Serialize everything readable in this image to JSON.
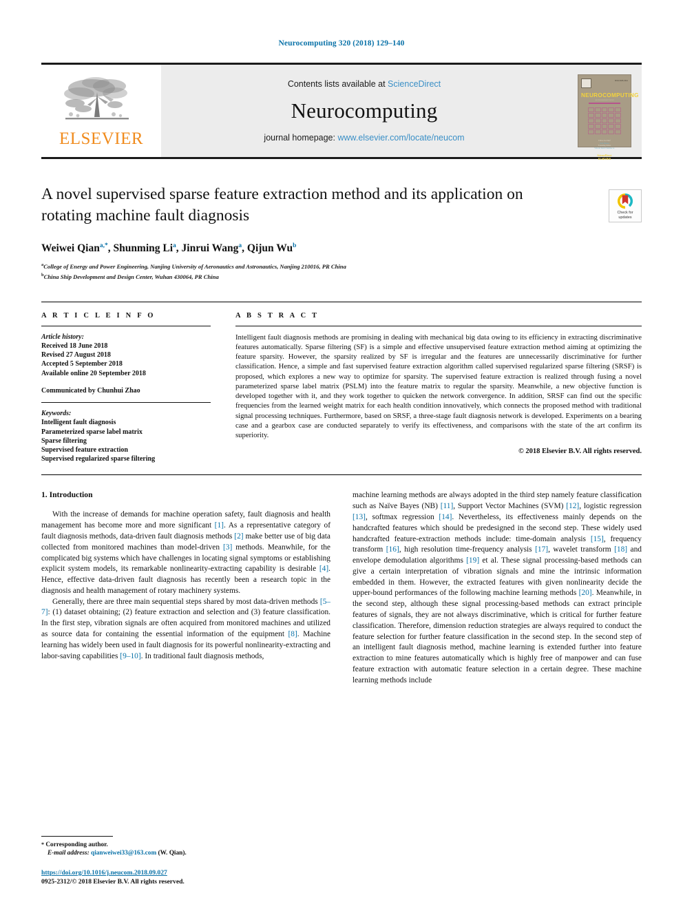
{
  "running_head": "Neurocomputing 320 (2018) 129–140",
  "masthead": {
    "contents_prefix": "Contents lists available at",
    "contents_link": "ScienceDirect",
    "journal_name": "Neurocomputing",
    "homepage_prefix": "journal homepage:",
    "homepage_link": "www.elsevier.com/locate/neucom",
    "publisher_logo_text": "ELSEVIER",
    "cover": {
      "title": "NEUROCOMPUTING",
      "subtitle": "An International Journal",
      "issn": "ISSN 0925-2312",
      "editor_label": "Editor-in-Chief",
      "editor_name": "Tom Heskes",
      "founding_label": "Founding Editor",
      "founding_name": "Vincent David Sánchez A.",
      "publisher_label": "Available online at",
      "publisher_name": "ScienceDirect",
      "publisher_brand": "ELSEVIER"
    }
  },
  "article": {
    "title": "A novel supervised sparse feature extraction method and its application on rotating machine fault diagnosis",
    "authors": [
      {
        "name": "Weiwei Qian",
        "sup": "a,*"
      },
      {
        "name": "Shunming Li",
        "sup": "a"
      },
      {
        "name": "Jinrui Wang",
        "sup": "a"
      },
      {
        "name": "Qijun Wu",
        "sup": "b"
      }
    ],
    "affiliations": [
      {
        "sup": "a",
        "text": "College of Energy and Power Engineering, Nanjing University of Aeronautics and Astronautics, Nanjing 210016, PR China"
      },
      {
        "sup": "b",
        "text": "China Ship Development and Design Center, Wuhan 430064, PR China"
      }
    ],
    "crossmark_label_line1": "Check for",
    "crossmark_label_line2": "updates"
  },
  "article_info": {
    "heading": "A R T I C L E   I N F O",
    "history_label": "Article history:",
    "history": [
      "Received 18 June 2018",
      "Revised 27 August 2018",
      "Accepted 5 September 2018",
      "Available online 20 September 2018"
    ],
    "communicated": "Communicated by Chunhui Zhao",
    "keywords_label": "Keywords:",
    "keywords": [
      "Intelligent fault diagnosis",
      "Parameterized sparse label matrix",
      "Sparse filtering",
      "Supervised feature extraction",
      "Supervised regularized sparse filtering"
    ]
  },
  "abstract": {
    "heading": "A B S T R A C T",
    "text": "Intelligent fault diagnosis methods are promising in dealing with mechanical big data owing to its efficiency in extracting discriminative features automatically. Sparse filtering (SF) is a simple and effective unsupervised feature extraction method aiming at optimizing the feature sparsity. However, the sparsity realized by SF is irregular and the features are unnecessarily discriminative for further classification. Hence, a simple and fast supervised feature extraction algorithm called supervised regularized sparse filtering (SRSF) is proposed, which explores a new way to optimize for sparsity. The supervised feature extraction is realized through fusing a novel parameterized sparse label matrix (PSLM) into the feature matrix to regular the sparsity. Meanwhile, a new objective function is developed together with it, and they work together to quicken the network convergence. In addition, SRSF can find out the specific frequencies from the learned weight matrix for each health condition innovatively, which connects the proposed method with traditional signal processing techniques. Furthermore, based on SRSF, a three-stage fault diagnosis network is developed. Experiments on a bearing case and a gearbox case are conducted separately to verify its effectiveness, and comparisons with the state of the art confirm its superiority.",
    "copyright": "© 2018 Elsevier B.V. All rights reserved."
  },
  "body": {
    "section_title": "1. Introduction",
    "left_paragraphs": [
      "With the increase of demands for machine operation safety, fault diagnosis and health management has become more and more significant [1]. As a representative category of fault diagnosis methods, data-driven fault diagnosis methods [2] make better use of big data collected from monitored machines than model-driven [3] methods. Meanwhile, for the complicated big systems which have challenges in locating signal symptoms or establishing explicit system models, its remarkable nonlinearity-extracting capability is desirable [4]. Hence, effective data-driven fault diagnosis has recently been a research topic in the diagnosis and health management of rotary machinery systems.",
      "Generally, there are three main sequential steps shared by most data-driven methods [5–7]: (1) dataset obtaining; (2) feature extraction and selection and (3) feature classification. In the first step, vibration signals are often acquired from monitored machines and utilized as source data for containing the essential information of the equipment [8]. Machine learning has widely been used in fault diagnosis for its powerful nonlinearity-extracting and labor-saving capabilities [9–10]. In traditional fault diagnosis methods,"
    ],
    "right_paragraphs": [
      "machine learning methods are always adopted in the third step namely feature classification such as Naïve Bayes (NB) [11], Support Vector Machines (SVM) [12], logistic regression [13], softmax regression [14]. Nevertheless, its effectiveness mainly depends on the handcrafted features which should be predesigned in the second step. These widely used handcrafted feature-extraction methods include: time-domain analysis [15], frequency transform [16], high resolution time-frequency analysis [17], wavelet transform [18] and envelope demodulation algorithms [19] et al. These signal processing-based methods can give a certain interpretation of vibration signals and mine the intrinsic information embedded in them. However, the extracted features with given nonlinearity decide the upper-bound performances of the following machine learning methods [20]. Meanwhile, in the second step, although these signal processing-based methods can extract principle features of signals, they are not always discriminative, which is critical for further feature classification. Therefore, dimension reduction strategies are always required to conduct the feature selection for further feature classification in the second step. In the second step of an intelligent fault diagnosis method, machine learning is extended further into feature extraction to mine features automatically which is highly free of manpower and can fuse feature extraction with automatic feature selection in a certain degree. These machine learning methods include"
    ]
  },
  "footer": {
    "corresponding_marker": "*",
    "corresponding_label": "Corresponding author.",
    "email_label": "E-mail address:",
    "email": "qianweiwei33@163.com",
    "email_owner": "(W. Qian).",
    "doi": "https://doi.org/10.1016/j.neucom.2018.09.027",
    "issn_copyright": "0925-2312/© 2018 Elsevier B.V. All rights reserved."
  },
  "colors": {
    "link_blue": "#0a72a8",
    "sciencedirect_blue": "#3a8fc6",
    "elsevier_orange": "#f08b1d",
    "cover_bg": "#a89c86",
    "cover_yellow": "#f2d23c"
  }
}
